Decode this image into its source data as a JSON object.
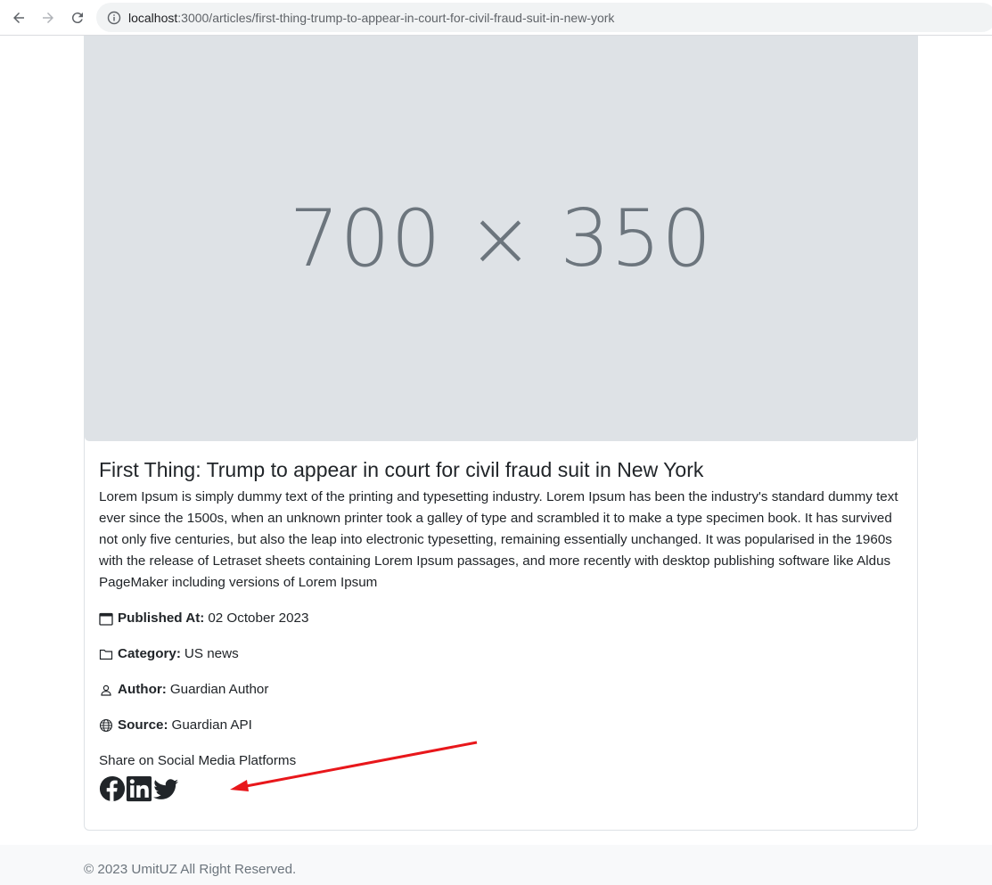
{
  "browser": {
    "url_host": "localhost",
    "url_rest": ":3000/articles/first-thing-trump-to-appear-in-court-for-civil-fraud-suit-in-new-york"
  },
  "article": {
    "image_placeholder": "700 × 350",
    "title": "First Thing: Trump to appear in court for civil fraud suit in New York",
    "description": "Lorem Ipsum is simply dummy text of the printing and typesetting industry. Lorem Ipsum has been the industry's standard dummy text ever since the 1500s, when an unknown printer took a galley of type and scrambled it to make a type specimen book. It has survived not only five centuries, but also the leap into electronic typesetting, remaining essentially unchanged. It was popularised in the 1960s with the release of Letraset sheets containing Lorem Ipsum passages, and more recently with desktop publishing software like Aldus PageMaker including versions of Lorem Ipsum",
    "published_label": "Published At:",
    "published_value": "02 October 2023",
    "category_label": "Category:",
    "category_value": "US news",
    "author_label": "Author:",
    "author_value": "Guardian Author",
    "source_label": "Source:",
    "source_value": "Guardian API",
    "share_label": "Share on Social Media Platforms",
    "share_icons": [
      "facebook-icon",
      "linkedin-icon",
      "twitter-icon"
    ]
  },
  "footer": {
    "text": "© 2023 UmitUZ All Right Reserved."
  },
  "colors": {
    "placeholder_bg": "#dee2e6",
    "placeholder_text": "#6c757d",
    "annotation_arrow": "#e8171b"
  }
}
